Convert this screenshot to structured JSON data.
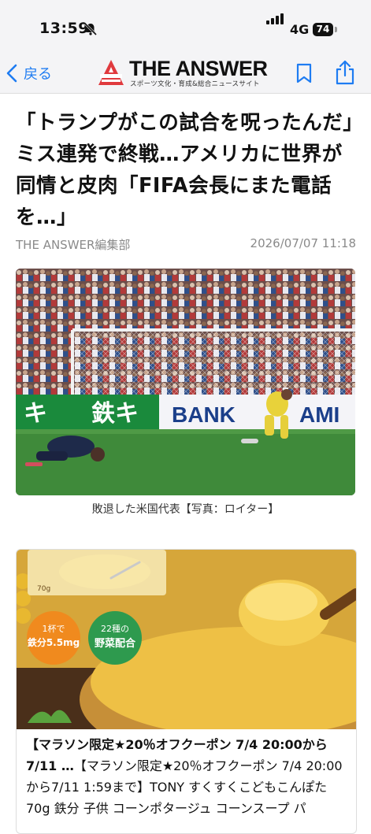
{
  "status_bar": {
    "time": "13:59",
    "network": "4G",
    "battery": "74"
  },
  "nav": {
    "back_label": "戻る",
    "logo_text": "THE ANSWER",
    "logo_subtitle": "スポーツ文化・育成&総合ニュースサイト"
  },
  "article": {
    "title": "「トランプがこの試合を呪ったんだ」　ミス連発で終戦…アメリカに世界が同情と皮肉「FIFA会長にまた電話を…」",
    "author": "THE ANSWER編集部",
    "date": "2026/07/07 11:18",
    "photo_caption": "敗退した米国代表【写真：ロイター】",
    "stadium_boards": [
      "キ",
      "鉄キ",
      "BANK",
      "AMI"
    ]
  },
  "ad": {
    "badges": [
      "1杯で",
      "鉄分5.5mg",
      "22種の",
      "野菜配合"
    ],
    "package_label": "70g",
    "title": "【マラソン限定★20％オフクーポン 7/4 20:00から7/11 …",
    "body": "【マラソン限定★20％オフクーポン 7/4 20:00から7/11 1:59まで】TONY すくすくこどもこんぽた 70g 鉄分 子供 コーンポタージュ コーンスープ パ"
  },
  "colors": {
    "accent": "#1e7cf2",
    "brand_red": "#e03a3e",
    "meta_gray": "#8a8a8a"
  }
}
